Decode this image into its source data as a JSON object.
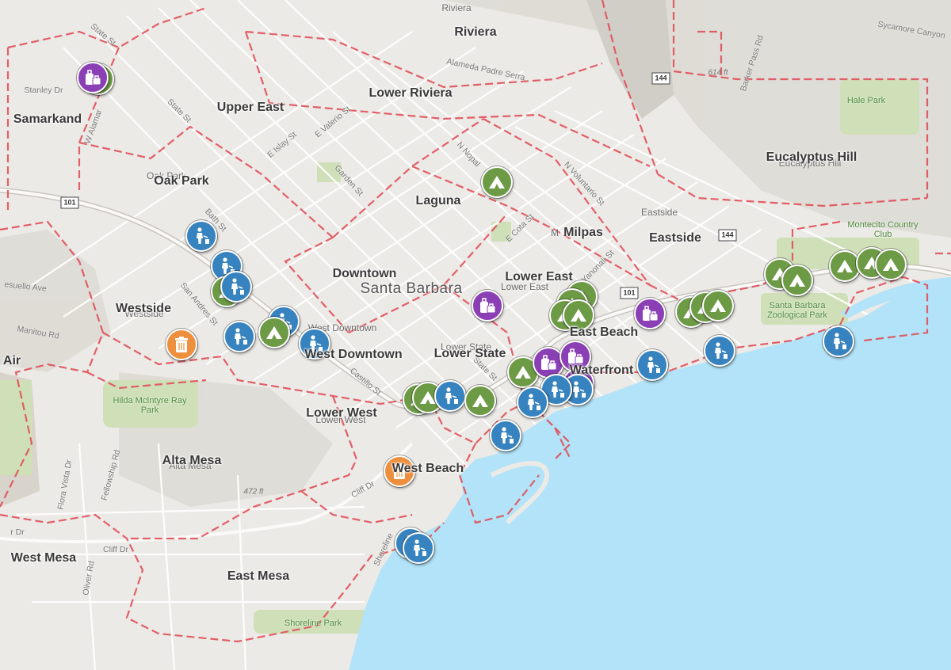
{
  "map": {
    "title": "",
    "colors": {
      "water": "#b2e3f8",
      "land": "#eceae6",
      "district_boundary": "#e0505a",
      "camp": "#6d9a45",
      "litter": "#3783bf",
      "bag": "#8a3fb5",
      "trash": "#ee8f3e"
    },
    "neighborhoods": {
      "riviera": "Riviera",
      "upper_east": "Upper East",
      "lower_riviera": "Lower Riviera",
      "samarkand": "Samarkand",
      "oak_park": "Oak Park",
      "laguna": "Laguna",
      "eucalyptus_hill": "Eucalyptus Hill",
      "milpas": "Milpas",
      "eastside": "Eastside",
      "downtown": "Downtown",
      "lower_east": "Lower East",
      "westside": "Westside",
      "east_beach": "East Beach",
      "west_downtown": "West Downtown",
      "lower_state": "Lower State",
      "waterfront": "Waterfront",
      "air": "Air",
      "lower_west": "Lower West",
      "alta_mesa": "Alta Mesa",
      "west_beach": "West Beach",
      "west_mesa": "West Mesa",
      "east_mesa": "East Mesa"
    },
    "base_labels": {
      "riviera": "Riviera",
      "oak_park": "Oak Park",
      "eucalyptus_hill": "Eucalyptus Hill",
      "eastside": "Eastside",
      "westside": "Westside",
      "west_downtown": "West Downtown",
      "lower_state": "Lower State",
      "lower_east": "Lower East",
      "lower_west": "Lower West",
      "alta_mesa": "Alta Mesa",
      "m": "M"
    },
    "city_label": "Santa Barbara",
    "parks": {
      "hale": "Hale Park",
      "montecito": "Montecito Country Club",
      "zoo": "Santa Barbara Zoological Park",
      "hilda": "Hilda McIntyre Ray Park",
      "shoreline": "Shoreline Park"
    },
    "streets": {
      "state_st_n": "State St",
      "stanley": "Stanley Dr",
      "alamar": "W Alamar",
      "alameda": "Alameda Padre Serra",
      "sycamore": "Sycamore Canyon",
      "barker": "Barker Pass Rd",
      "state_st_mid": "State St",
      "e_islay": "E Islay St",
      "e_valerio": "E Valerio St",
      "garden": "Garden St",
      "n_nopal": "N Nopal",
      "n_voluntario": "N Voluntario St",
      "bath": "Bath St",
      "e_cota": "E Cota St",
      "e_yanonali": "E Yanonali St",
      "san_andres": "San Andres St",
      "castillo": "Castillo St",
      "state_st_low": "State St",
      "mesuello": "esuello Ave",
      "manitou": "Manitou Rd",
      "cliff_dr": "Cliff Dr",
      "cliff_dr_w": "Cliff Dr",
      "fellowship": "Fellowship Rd",
      "flora": "Flora Vista Dr",
      "oliver": "Oliver Rd",
      "shoreline": "Shoreline",
      "r_dr": "r Dr"
    },
    "elevations": {
      "e614": "614 ft",
      "e472": "472 ft"
    },
    "shields": {
      "us101_a": "101",
      "us101_b": "101",
      "ca144_a": "144",
      "ca144_b": "144"
    },
    "marker_legend": {
      "camp": "camp-icon",
      "litter": "litter-icon",
      "bag": "luggage-icon",
      "trash": "trash-can-icon"
    }
  }
}
